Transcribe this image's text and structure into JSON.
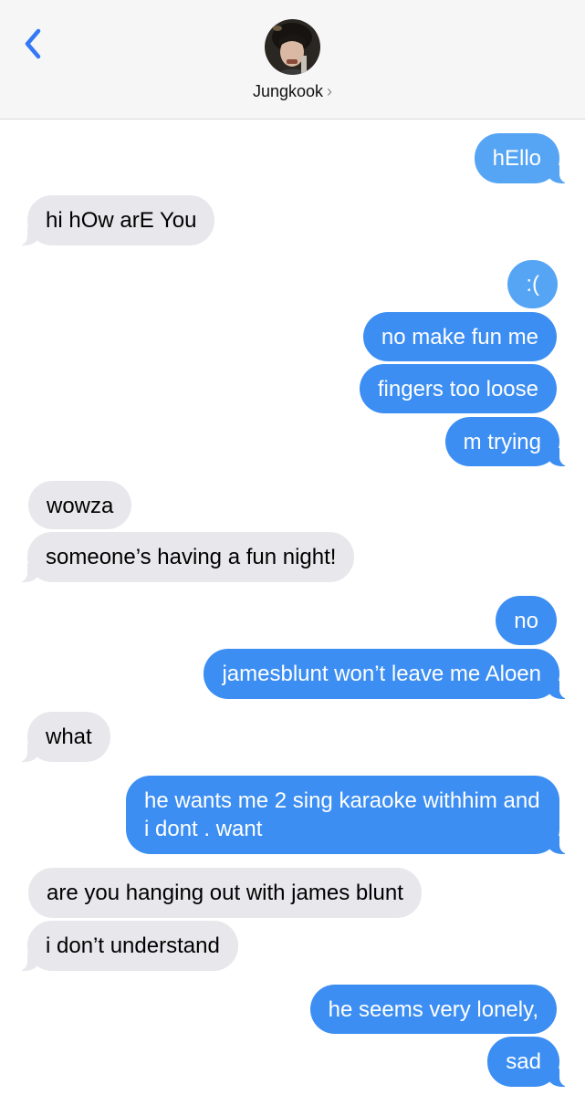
{
  "header": {
    "contact_name": "Jungkook",
    "chevron": "›",
    "back_icon": "chevron-left-icon"
  },
  "colors": {
    "sent_bubble": "#3c8ef2",
    "received_bubble": "#e8e8ec",
    "back_accent": "#3478f6"
  },
  "messages": [
    {
      "sender": "me",
      "text": "hEllo"
    },
    {
      "sender": "them",
      "text": "hi hOw arE You"
    },
    {
      "sender": "me",
      "text": ":("
    },
    {
      "sender": "me",
      "text": "no make fun me"
    },
    {
      "sender": "me",
      "text": "fingers too loose"
    },
    {
      "sender": "me",
      "text": "m trying"
    },
    {
      "sender": "them",
      "text": "wowza"
    },
    {
      "sender": "them",
      "text": "someone’s having a fun night!"
    },
    {
      "sender": "me",
      "text": "no"
    },
    {
      "sender": "me",
      "text": "jamesblunt won’t leave me Aloen"
    },
    {
      "sender": "them",
      "text": "what"
    },
    {
      "sender": "me",
      "text": "he wants me 2 sing karaoke withhim and i dont . want"
    },
    {
      "sender": "them",
      "text": "are you hanging out with james blunt"
    },
    {
      "sender": "them",
      "text": "i don’t understand"
    },
    {
      "sender": "me",
      "text": "he seems very lonely,"
    },
    {
      "sender": "me",
      "text": "sad"
    }
  ]
}
